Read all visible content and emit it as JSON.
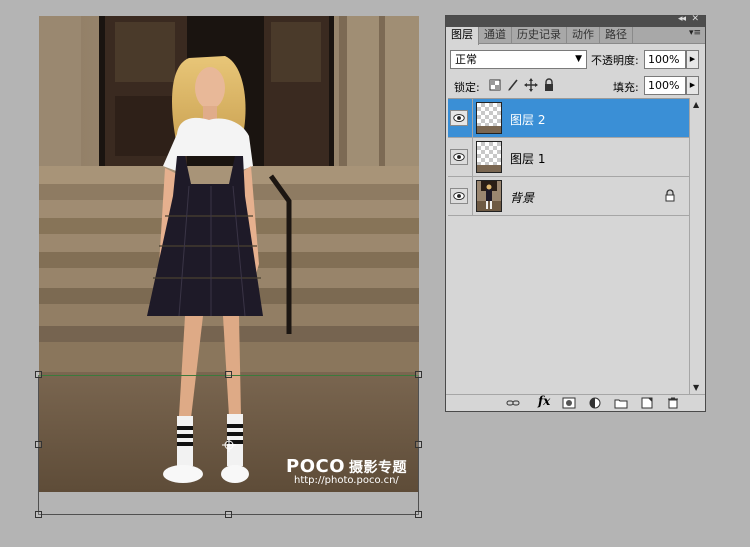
{
  "panel": {
    "tabs": [
      {
        "label": "图层",
        "active": true
      },
      {
        "label": "通道",
        "active": false
      },
      {
        "label": "历史记录",
        "active": false
      },
      {
        "label": "动作",
        "active": false
      },
      {
        "label": "路径",
        "active": false
      }
    ],
    "collapse_glyph": "◂◂",
    "close_glyph": "✕",
    "menu_glyph": "▾≡",
    "blend_mode": "正常",
    "opacity_label": "不透明度:",
    "opacity_value": "100%",
    "lock_label": "锁定:",
    "fill_label": "填充:",
    "fill_value": "100%",
    "layers": [
      {
        "name": "图层 2",
        "selected": true,
        "visible": true,
        "thumb": "transparent-with-strip"
      },
      {
        "name": "图层 1",
        "selected": false,
        "visible": true,
        "thumb": "transparent-with-strip"
      },
      {
        "name": "背景",
        "selected": false,
        "visible": true,
        "thumb": "photo",
        "locked": true
      }
    ],
    "selection_color": "#3a8fd6",
    "footer_icons": [
      "link-icon",
      "fx-icon",
      "mask-icon",
      "adjustment-icon",
      "group-folder-icon",
      "new-layer-icon",
      "trash-icon"
    ],
    "fx_label": "fx"
  },
  "watermark": {
    "brand": "POCO",
    "brand_zh": "摄影专题",
    "url": "http://photo.poco.cn/"
  }
}
